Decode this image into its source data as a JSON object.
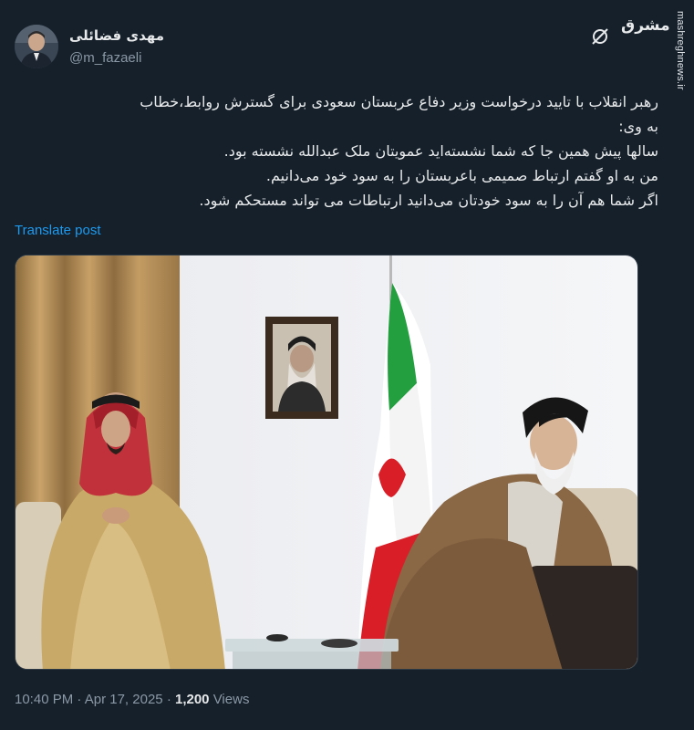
{
  "author": {
    "display_name": "مهدی فضائلی",
    "handle": "@m_fazaeli"
  },
  "brand": {
    "logo_text": "مشرق",
    "watermark": "mashreghnews.ir"
  },
  "post": {
    "lines": [
      "رهبر انقلاب با تایید درخواست وزیر دفاع عربستان سعودی برای گسترش روابط،خطاب",
      "به وی:",
      "سالها پیش همین جا که شما نشسته‌اید عمویتان ملک عبدالله نشسته بود.",
      "من به او گفتم ارتباط صمیمی باعربستان را به سود خود می‌دانیم.",
      " اگر شما هم آن را به سود خودتان می‌دانید ارتباطات می تواند مستحکم شود."
    ],
    "translate_label": "Translate post"
  },
  "meta": {
    "time": "10:40 PM",
    "separator": "·",
    "date": "Apr 17, 2025",
    "views_count": "1,200",
    "views_label": "Views"
  },
  "icons": {
    "grok": "slashed-circle-icon"
  },
  "colors": {
    "background": "#15202b",
    "text": "#e7e9ea",
    "muted": "#8b98a5",
    "link": "#1d9bf0"
  }
}
